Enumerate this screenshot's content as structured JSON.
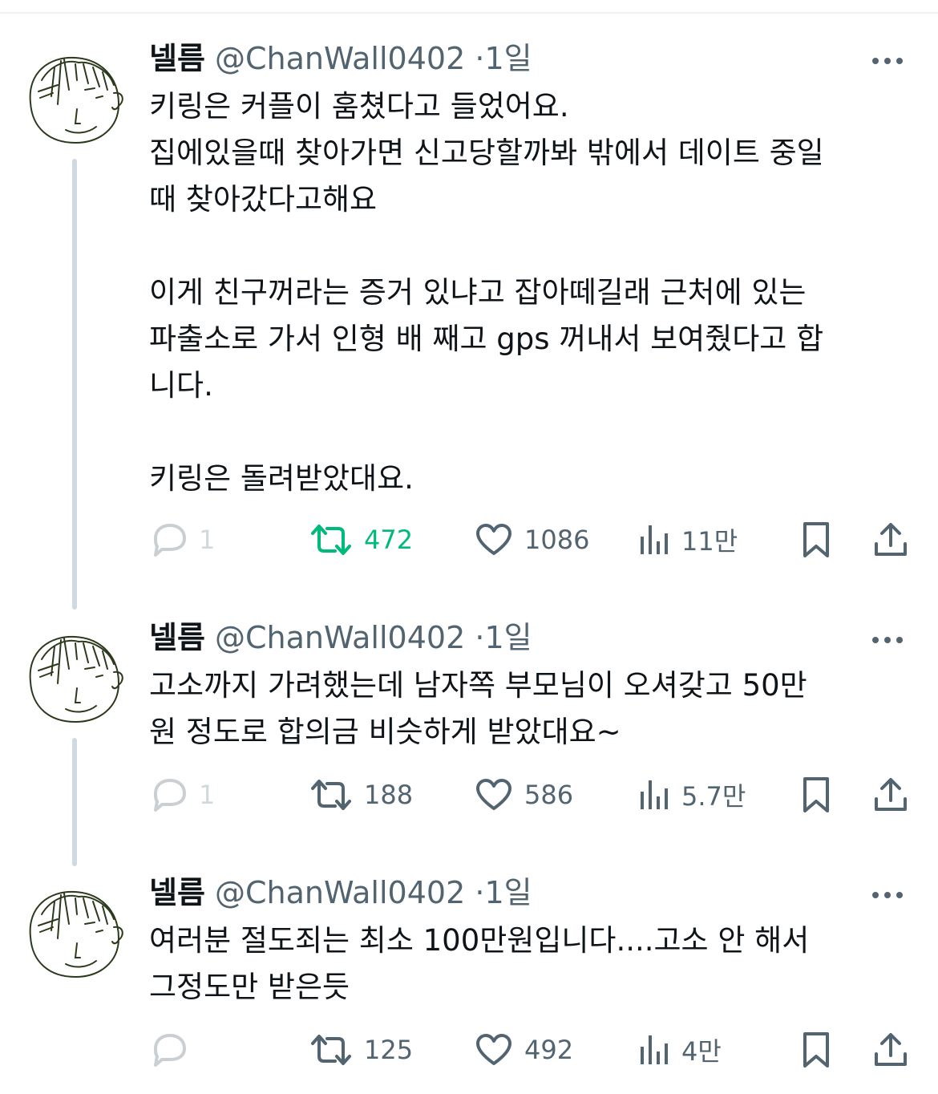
{
  "tweets": [
    {
      "name": "넬름",
      "handle": "@ChanWall0402",
      "time": "1일",
      "text": "키링은 커플이 훔쳤다고 들었어요.\n집에있을때 찾아가면 신고당할까봐 밖에서 데이트 중일\n때 찾아갔다고해요\n\n이게 친구꺼라는 증거 있냐고 잡아떼길래 근처에 있는\n파출소로 가서 인형 배 째고 gps 꺼내서 보여줬다고 합\n니다.\n\n키링은 돌려받았대요.",
      "replies": "1",
      "retweets": "472",
      "likes": "1086",
      "views": "11만",
      "retweeted": true
    },
    {
      "name": "넬름",
      "handle": "@ChanWall0402",
      "time": "1일",
      "text": "고소까지 가려했는데 남자쪽 부모님이 오셔갖고 50만\n원 정도로 합의금 비슷하게 받았대요~",
      "replies": "1",
      "retweets": "188",
      "likes": "586",
      "views": "5.7만",
      "retweeted": false
    },
    {
      "name": "넬름",
      "handle": "@ChanWall0402",
      "time": "1일",
      "text": "여러분 절도죄는 최소 100만원입니다....고소 안 해서\n그정도만 받은듯",
      "replies": "",
      "retweets": "125",
      "likes": "492",
      "views": "4만",
      "retweeted": false
    }
  ],
  "separator": "·",
  "icons": [
    "more-icon",
    "reply-icon",
    "retweet-icon",
    "like-icon",
    "views-icon",
    "bookmark-icon",
    "share-icon"
  ],
  "colors": {
    "text": "#0f1419",
    "secondary": "#536471",
    "retweet_active": "#00ba7c",
    "thread_line": "#cfd9de"
  }
}
